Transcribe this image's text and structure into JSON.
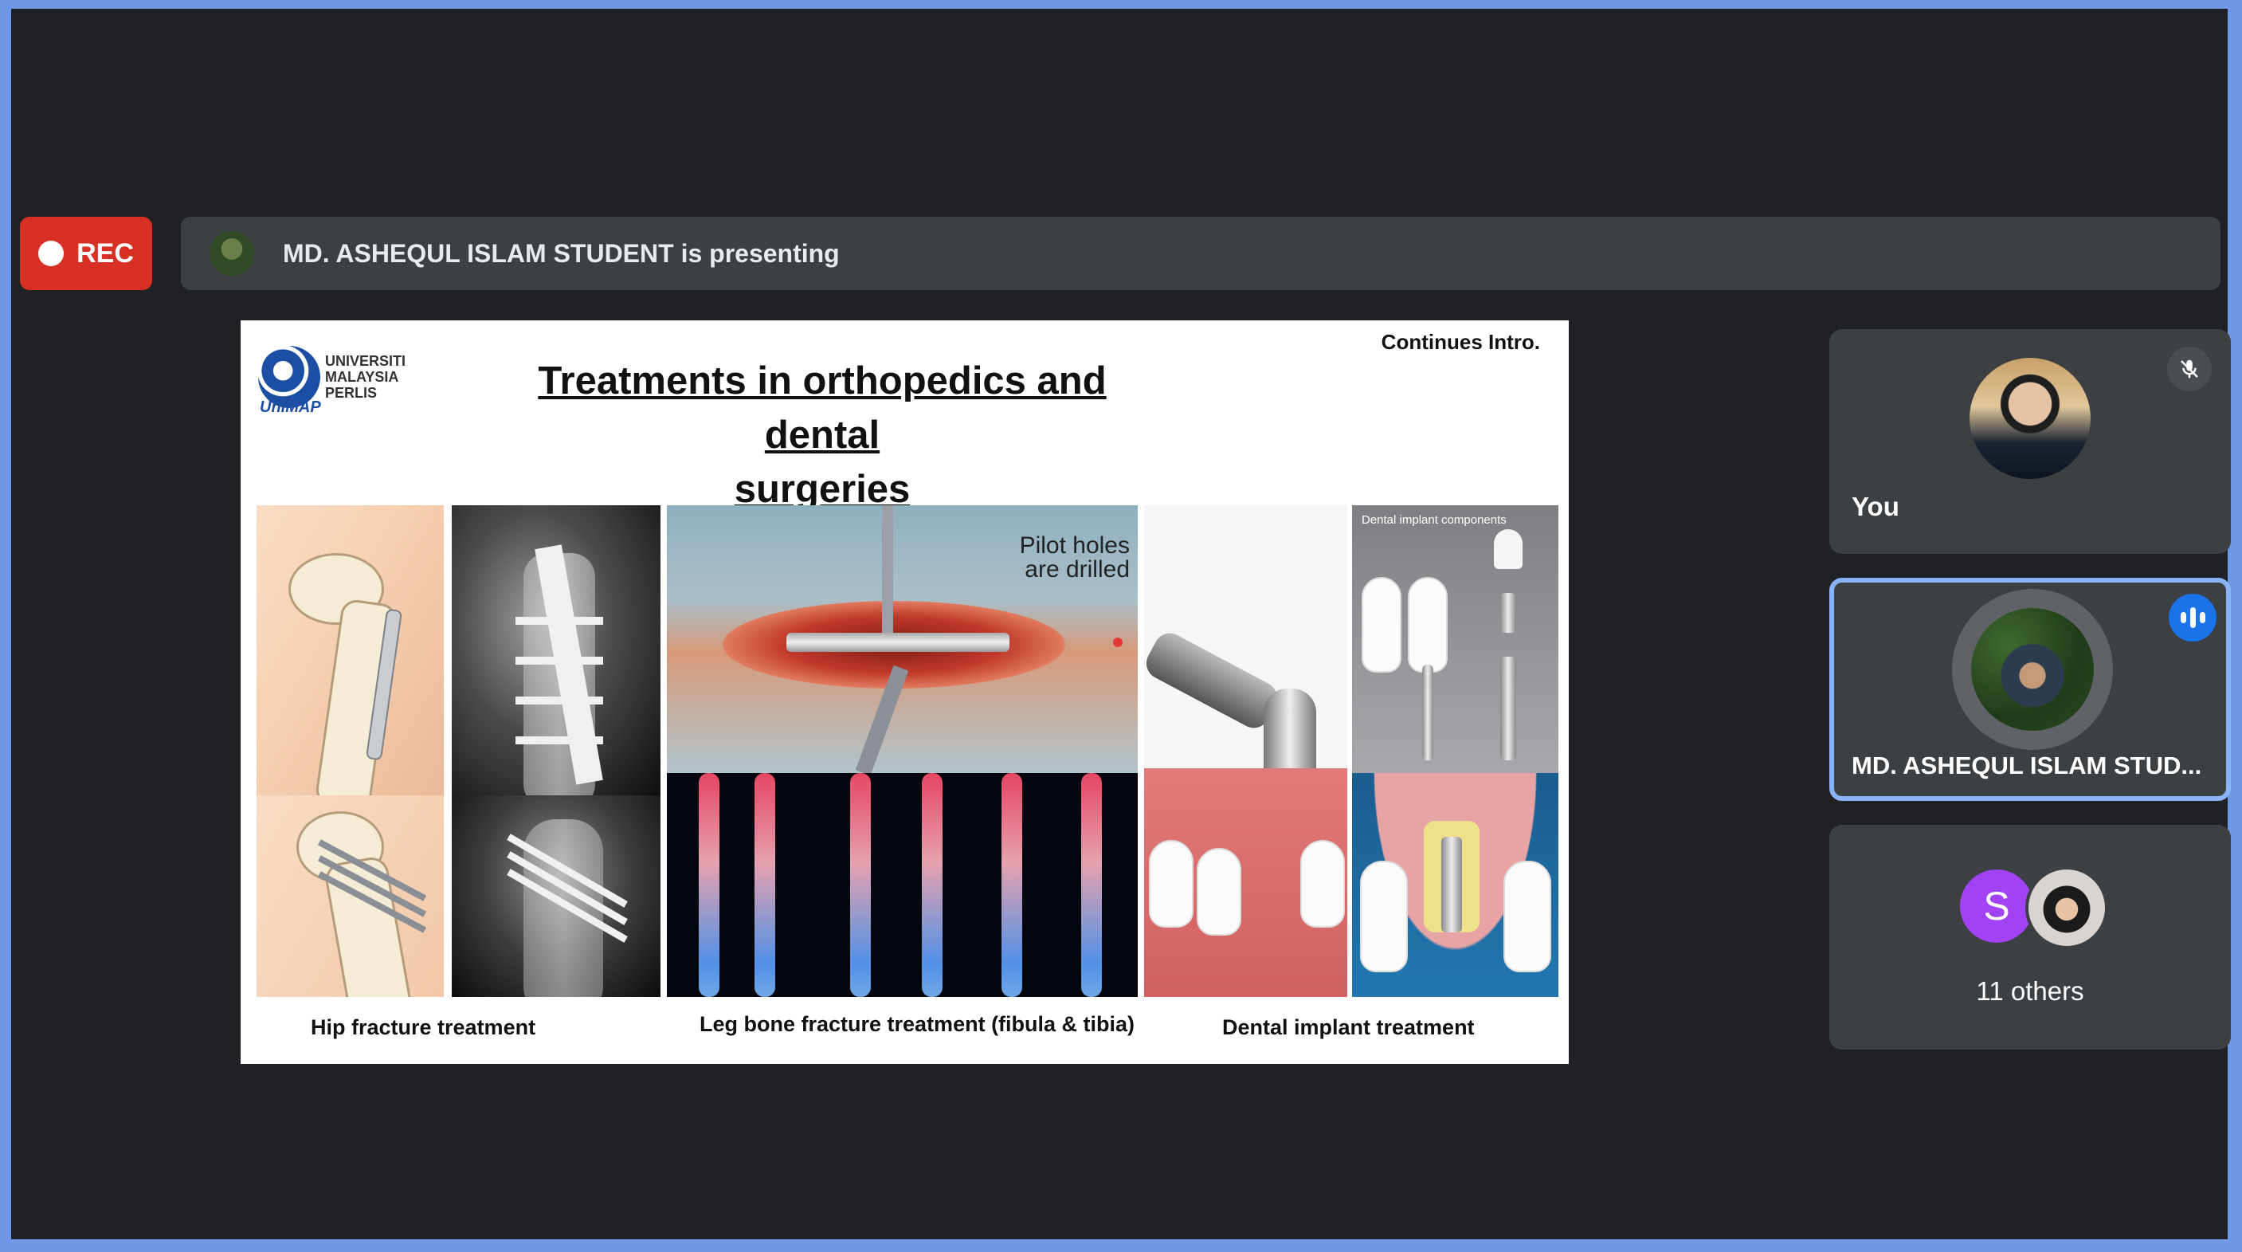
{
  "rec": {
    "label": "REC",
    "color": "#d93025"
  },
  "presenting_bar": {
    "text": "MD. ASHEQUL ISLAM STUDENT is presenting"
  },
  "slide": {
    "logo_lines": [
      "UNIVERSITI",
      "MALAYSIA",
      "PERLIS"
    ],
    "logo_brand": "UniMAP",
    "corner_note": "Continues Intro.",
    "title_line1": "Treatments in orthopedics and dental",
    "title_line2": "surgeries",
    "pilot_text_line1": "Pilot holes",
    "pilot_text_line2": "are drilled",
    "dental_panel_label": "Dental implant components",
    "captions": {
      "hip": "Hip fracture treatment",
      "leg": "Leg bone fracture treatment (fibula & tibia)",
      "dental": "Dental implant treatment"
    }
  },
  "participants": {
    "you": {
      "name": "You",
      "mic_icon": "mic-off-icon"
    },
    "presenter": {
      "name": "MD. ASHEQUL ISLAM STUD...",
      "status_icon": "speaking-icon"
    },
    "others": {
      "initial": "S",
      "label": "11 others",
      "initial_color": "#a142f4"
    }
  },
  "colors": {
    "accent": "#8ab4f8",
    "tile_bg": "#3c4043",
    "background": "#202124"
  }
}
